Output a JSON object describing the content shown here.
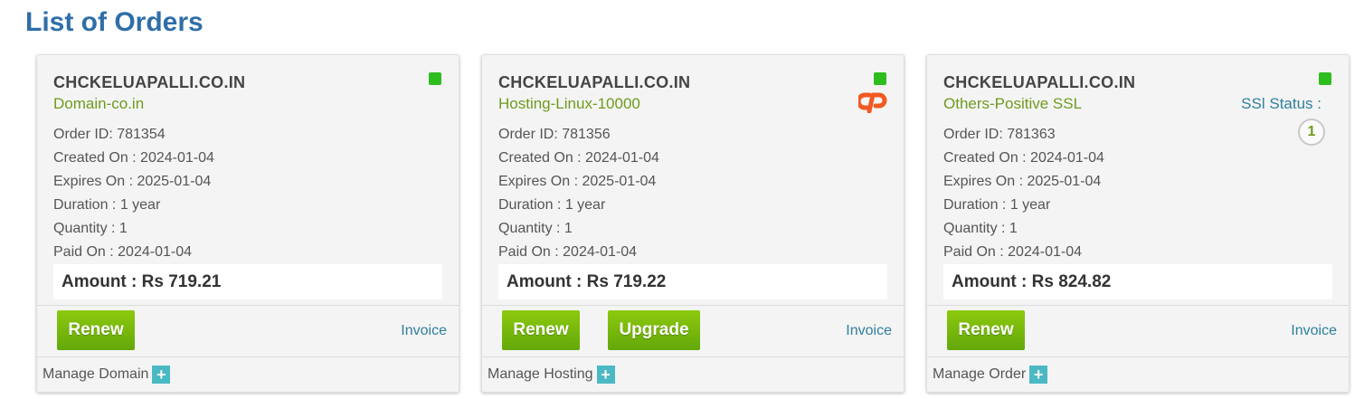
{
  "page": {
    "title": "List of Orders"
  },
  "orders": [
    {
      "domain": "CHCKELUAPALLI.CO.IN",
      "product": "Domain-co.in",
      "order_id": "Order ID: 781354",
      "created_on": "Created On : 2024-01-04",
      "expires_on": "Expires On : 2025-01-04",
      "duration": "Duration : 1 year",
      "quantity": "Quantity : 1",
      "paid_on": "Paid On : 2024-01-04",
      "amount": "Amount : Rs 719.21",
      "renew_label": "Renew",
      "invoice_label": "Invoice",
      "manage_label": "Manage Domain",
      "plus_icon": "+",
      "status_color": "#2dbd1f"
    },
    {
      "domain": "CHCKELUAPALLI.CO.IN",
      "product": "Hosting-Linux-10000",
      "order_id": "Order ID: 781356",
      "created_on": "Created On : 2024-01-04",
      "expires_on": "Expires On : 2025-01-04",
      "duration": "Duration : 1 year",
      "quantity": "Quantity : 1",
      "paid_on": "Paid On : 2024-01-04",
      "amount": "Amount : Rs 719.22",
      "renew_label": "Renew",
      "upgrade_label": "Upgrade",
      "invoice_label": "Invoice",
      "manage_label": "Manage Hosting",
      "plus_icon": "+",
      "icon": "cpanel-logo-icon",
      "status_color": "#2dbd1f"
    },
    {
      "domain": "CHCKELUAPALLI.CO.IN",
      "product": "Others-Positive SSL",
      "order_id": "Order ID: 781363",
      "created_on": "Created On : 2024-01-04",
      "expires_on": "Expires On : 2025-01-04",
      "duration": "Duration : 1 year",
      "quantity": "Quantity : 1",
      "paid_on": "Paid On : 2024-01-04",
      "amount": "Amount : Rs 824.82",
      "ssl_status_label": "SSl Status :",
      "ssl_status_value": "1",
      "renew_label": "Renew",
      "invoice_label": "Invoice",
      "manage_label": "Manage Order",
      "plus_icon": "+",
      "status_color": "#2dbd1f"
    }
  ],
  "colors": {
    "title": "#2f6ea8",
    "product": "#6e9b1d",
    "button": "#7ab80c",
    "link": "#2f7f9f",
    "plus": "#4ab9c3"
  }
}
